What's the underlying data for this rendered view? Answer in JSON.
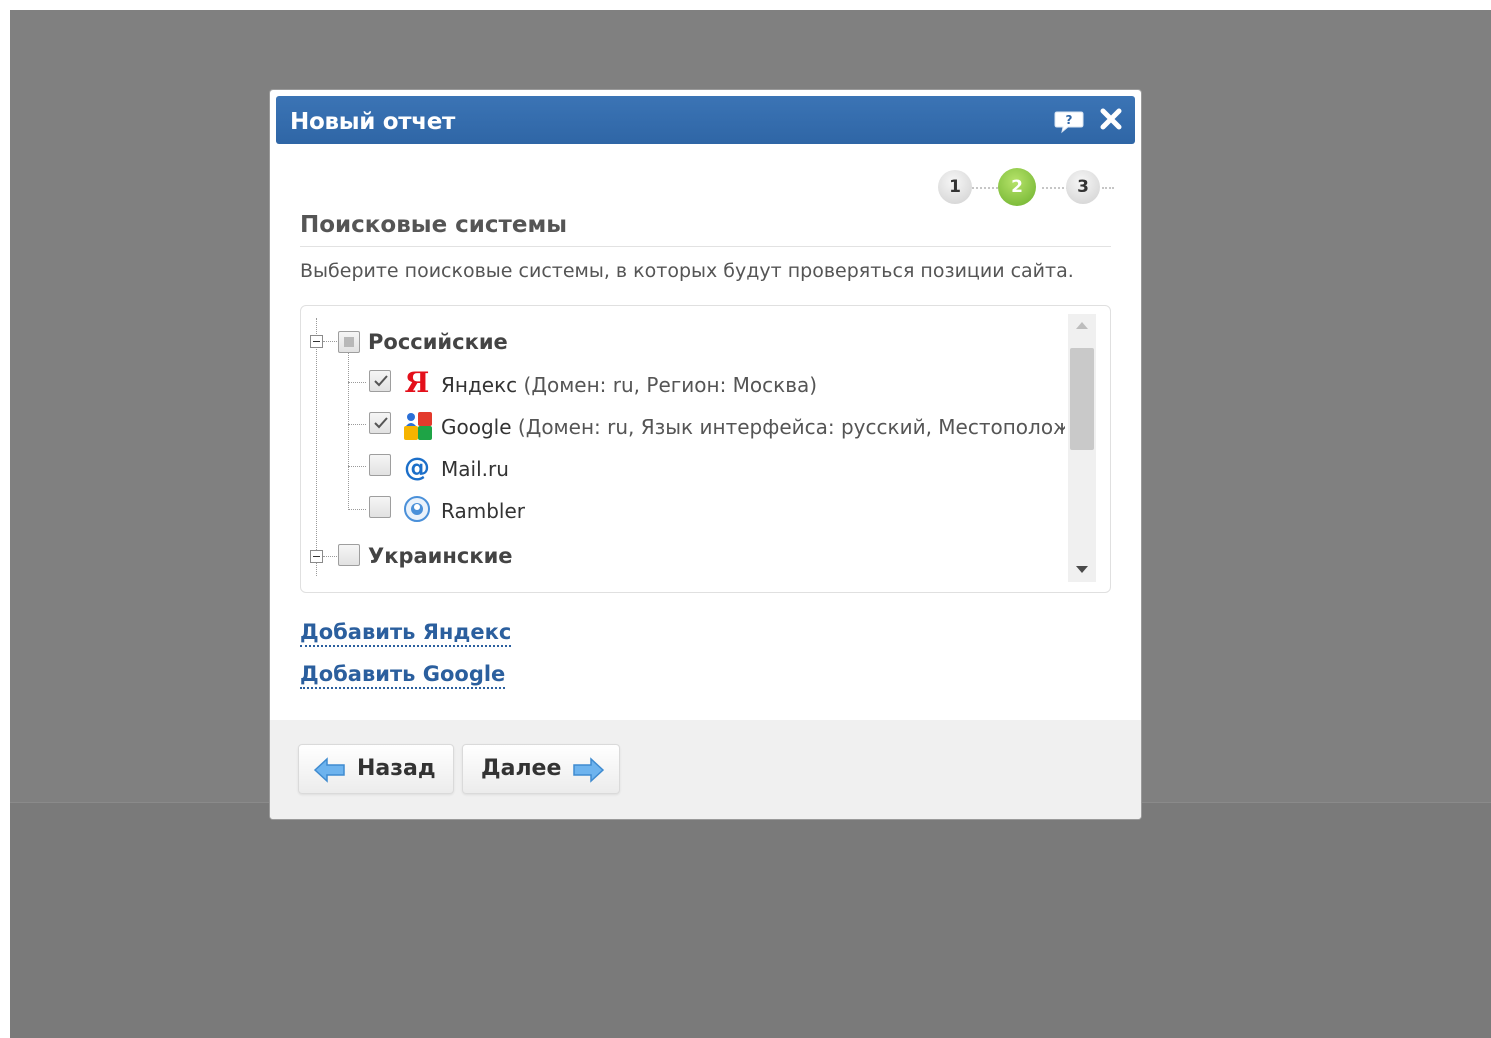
{
  "dialog": {
    "title": "Новый отчет",
    "help_icon": "help-bubble-icon",
    "close_icon": "close-icon"
  },
  "steps": [
    "1",
    "2",
    "3"
  ],
  "active_step": "2",
  "section": {
    "title": "Поисковые системы",
    "description": "Выберите поисковые системы, в которых будут проверяться позиции сайта."
  },
  "tree": {
    "groups": [
      {
        "label": "Российские",
        "state": "partial",
        "items": [
          {
            "brand": "Яндекс",
            "details": " (Домен: ru, Регион: Москва)",
            "checked": true,
            "icon": "yandex-icon"
          },
          {
            "brand": "Google",
            "details": " (Домен: ru, Язык интерфейса: русский, Местоположен",
            "checked": true,
            "icon": "google-icon"
          },
          {
            "brand": "Mail.ru",
            "details": "",
            "checked": false,
            "icon": "mailru-icon"
          },
          {
            "brand": "Rambler",
            "details": "",
            "checked": false,
            "icon": "rambler-icon"
          }
        ]
      },
      {
        "label": "Украинские",
        "state": "unchecked",
        "items": []
      }
    ]
  },
  "links": {
    "add_yandex": "Добавить Яндекс",
    "add_google": "Добавить Google"
  },
  "footer": {
    "back_label": "Назад",
    "next_label": "Далее"
  },
  "colors": {
    "titlebar": "#3169ab",
    "link": "#2b5f9e",
    "active_step": "#7dbf36",
    "backdrop": "#808080"
  }
}
